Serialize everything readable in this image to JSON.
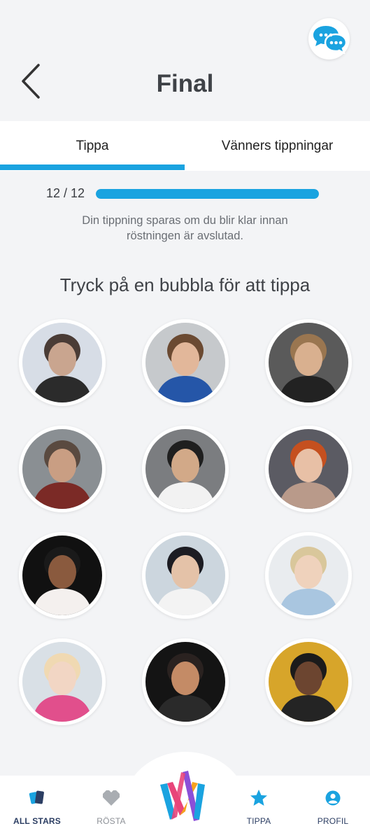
{
  "header": {
    "title": "Final",
    "back_icon": "chevron-left-icon",
    "chat_icon": "chat-bubbles-icon",
    "chat_color": "#1aa3e0"
  },
  "tabs": [
    {
      "label": "Tippa",
      "active": true
    },
    {
      "label": "Vänners tippningar",
      "active": false
    }
  ],
  "progress": {
    "label": "12 / 12",
    "fraction": 1.0,
    "color": "#1aa3e0"
  },
  "hint_line1": "Din tippning sparas om du blir klar innan",
  "hint_line2": "röstningen är avslutad.",
  "section_title": "Tryck på en bubbla för att tippa",
  "contestants": [
    {
      "id": 1
    },
    {
      "id": 2
    },
    {
      "id": 3
    },
    {
      "id": 4
    },
    {
      "id": 5
    },
    {
      "id": 6
    },
    {
      "id": 7
    },
    {
      "id": 8
    },
    {
      "id": 9
    },
    {
      "id": 10
    },
    {
      "id": 11
    },
    {
      "id": 12
    }
  ],
  "bottom_nav": [
    {
      "label": "ALL STARS",
      "icon": "cards-icon"
    },
    {
      "label": "RÖSTA",
      "icon": "heart-icon"
    },
    {
      "label": "",
      "icon": "melodifestivalen-logo"
    },
    {
      "label": "TIPPA",
      "icon": "star-icon"
    },
    {
      "label": "PROFIL",
      "icon": "profile-icon"
    }
  ],
  "colors": {
    "accent": "#1aa3e0",
    "nav_active": "#2c3e63",
    "nav_inactive": "#8d9197",
    "background": "#f3f4f6"
  }
}
